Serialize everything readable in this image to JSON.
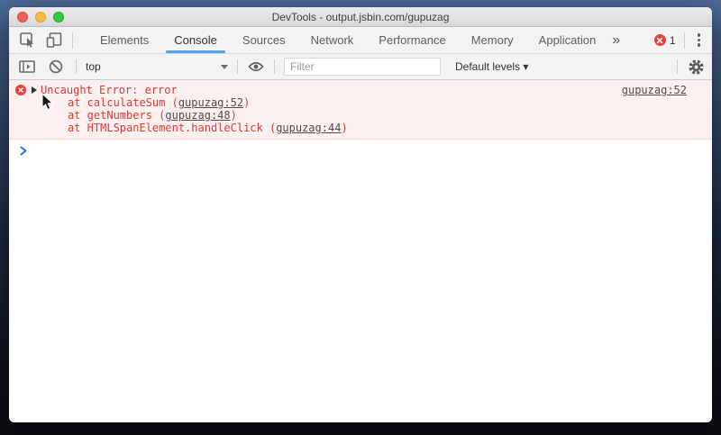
{
  "window": {
    "title": "DevTools - output.jsbin.com/gupuzag",
    "traffic_lights": [
      "close",
      "minimize",
      "zoom"
    ]
  },
  "tab_bar": {
    "tabs": [
      {
        "label": "Elements",
        "active": false
      },
      {
        "label": "Console",
        "active": true
      },
      {
        "label": "Sources",
        "active": false
      },
      {
        "label": "Network",
        "active": false
      },
      {
        "label": "Performance",
        "active": false
      },
      {
        "label": "Memory",
        "active": false
      },
      {
        "label": "Application",
        "active": false
      }
    ],
    "overflow_chevron": "»",
    "error_badge_count": "1"
  },
  "toolbar": {
    "context_selector_value": "top",
    "filter_placeholder": "Filter",
    "filter_value": "",
    "levels_dropdown_value": "Default levels ▾"
  },
  "console": {
    "error": {
      "message": "Uncaught Error: error",
      "stack": [
        {
          "prefix": "at calculateSum (",
          "link": "gupuzag:52",
          "suffix": ")"
        },
        {
          "prefix": "at getNumbers (",
          "link": "gupuzag:48",
          "suffix": ")"
        },
        {
          "prefix": "at HTMLSpanElement.handleClick (",
          "link": "gupuzag:44",
          "suffix": ")"
        }
      ],
      "source_link": "gupuzag:52"
    }
  },
  "icons": {
    "inspect": "cursor-in-box",
    "device-toolbar": "phone-and-tablet",
    "console-sidebar": "panel-with-play",
    "clear-console": "circle-slash",
    "eye": "live-expression-eye",
    "gear": "settings-gear",
    "kebab": "three-vertical-dots",
    "error": "red-circle-x",
    "prompt": "blue-chevron-right"
  },
  "colors": {
    "accent_blue": "#53a1ee",
    "error_red": "#e8372f",
    "error_bg": "#fdf0f0",
    "error_border": "#ffd7d7",
    "badge_red": "#e8413c",
    "toolbar_bg": "#f3f3f3"
  }
}
